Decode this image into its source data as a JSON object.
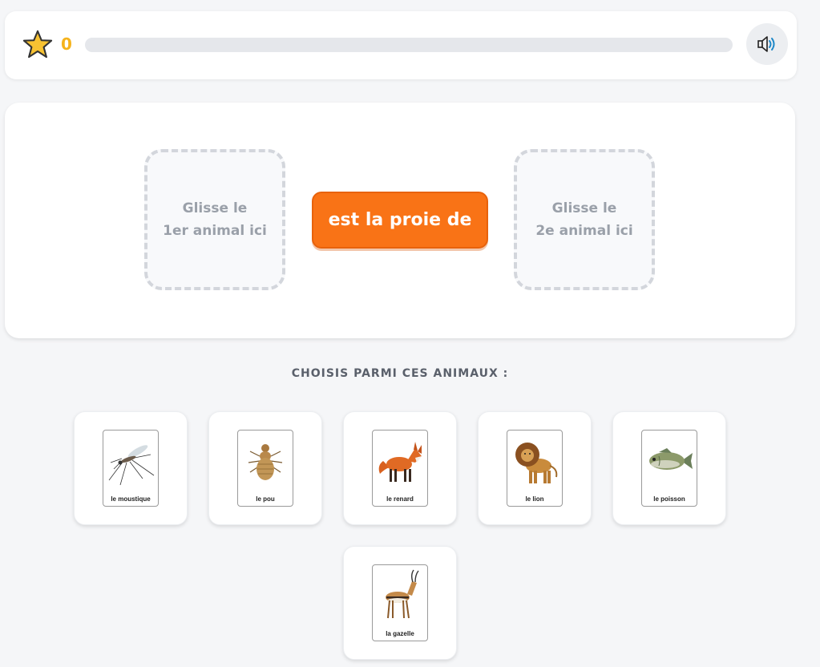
{
  "header": {
    "score": "0",
    "progress": 0,
    "sound_icon": "speaker-icon",
    "star_icon": "star-icon",
    "accent_color": "#f5b31c"
  },
  "sentence": {
    "slot1_text": "Glisse le\n1er animal ici",
    "relation": "est la proie de",
    "slot2_text": "Glisse le\n2e animal ici",
    "relation_color": "#f97316"
  },
  "choices": {
    "label": "CHOISIS PARMI CES ANIMAUX :",
    "animals": [
      {
        "name": "le moustique",
        "icon": "mosquito-icon"
      },
      {
        "name": "le pou",
        "icon": "louse-icon"
      },
      {
        "name": "le renard",
        "icon": "fox-icon"
      },
      {
        "name": "le lion",
        "icon": "lion-icon"
      },
      {
        "name": "le poisson",
        "icon": "fish-icon"
      },
      {
        "name": "la gazelle",
        "icon": "gazelle-icon"
      }
    ]
  }
}
